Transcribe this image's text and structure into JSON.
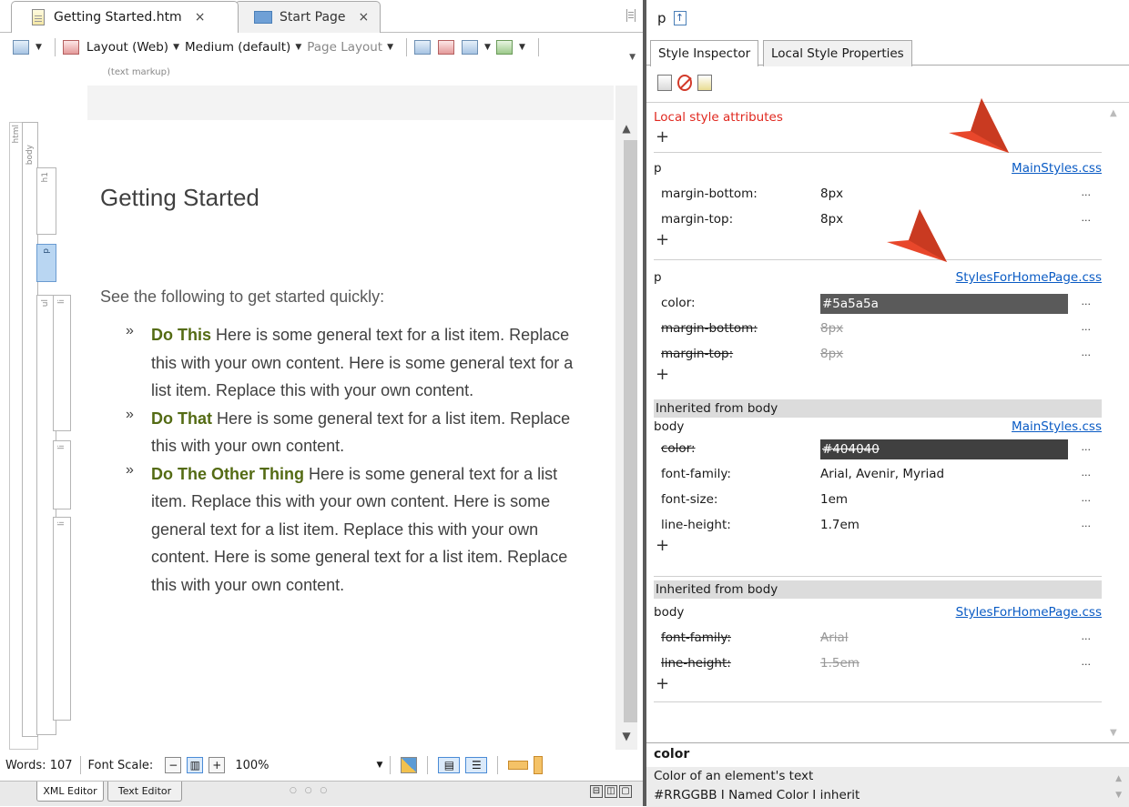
{
  "tabs": {
    "doc_tab": "Getting Started.htm",
    "start_tab": "Start Page",
    "close_glyph": "×"
  },
  "toolbar": {
    "layout": "Layout (Web)",
    "medium": "Medium (default)",
    "page_layout": "Page Layout"
  },
  "editor": {
    "markup_hint": "(text markup)",
    "structure_labels": [
      "html",
      "body",
      "h1",
      "p",
      "ul",
      "li",
      "li",
      "li"
    ],
    "heading": "Getting Started",
    "intro": "See the following to get started quickly:",
    "bullet_glyph": "»",
    "items": [
      {
        "lead": "Do This",
        "text": " Here is some general text for a list item. Replace this with your own content. Here is some general text for a list item. Replace this with your own content."
      },
      {
        "lead": "Do That",
        "text": " Here is some general text for a list item. Replace this with your own content."
      },
      {
        "lead": "Do The Other Thing",
        "text": " Here is some general text for a list item. Replace this with your own content. Here is some general text for a list item. Replace this with your own content. Here is some general text for a list item. Replace this with your own content."
      }
    ]
  },
  "status": {
    "words": "Words: 107",
    "font_scale_label": "Font Scale:",
    "zoom": "100%"
  },
  "editor_tabs": {
    "xml": "XML Editor",
    "text": "Text Editor",
    "dots": "○ ○ ○"
  },
  "inspector": {
    "element": "p",
    "tabs": [
      "Style Inspector",
      "Local Style Properties"
    ],
    "local_title": "Local style attributes",
    "plus": "+",
    "dots": "...",
    "sections": [
      {
        "selector": "p",
        "file": "MainStyles.css",
        "props": [
          {
            "name": "margin-bottom:",
            "value": "8px"
          },
          {
            "name": "margin-top:",
            "value": "8px"
          }
        ]
      },
      {
        "selector": "p",
        "file": "StylesForHomePage.css",
        "props": [
          {
            "name": "color:",
            "value": "#5a5a5a"
          },
          {
            "name": "margin-bottom:",
            "value": "8px"
          },
          {
            "name": "margin-top:",
            "value": "8px"
          }
        ]
      },
      {
        "inherited": "Inherited from body",
        "selector": "body",
        "file": "MainStyles.css",
        "props": [
          {
            "name": "color:",
            "value": "#404040"
          },
          {
            "name": "font-family:",
            "value": "Arial, Avenir, Myriad"
          },
          {
            "name": "font-size:",
            "value": "1em"
          },
          {
            "name": "line-height:",
            "value": "1.7em"
          }
        ]
      },
      {
        "inherited": "Inherited from body",
        "selector": "body",
        "file": "StylesForHomePage.css",
        "props": [
          {
            "name": "font-family:",
            "value": "Arial"
          },
          {
            "name": "line-height:",
            "value": "1.5em"
          }
        ]
      }
    ],
    "description": {
      "title": "color",
      "line1": "Color of an element's text",
      "line2": "#RRGGBB I Named Color I inherit"
    }
  },
  "colors": {
    "swatch_p_color": "#5a5a5a",
    "swatch_body_color": "#404040",
    "list_lead": "#546b14",
    "link": "#0a5bc4",
    "local_title": "#e0281f",
    "arrow": "#e8472b"
  }
}
